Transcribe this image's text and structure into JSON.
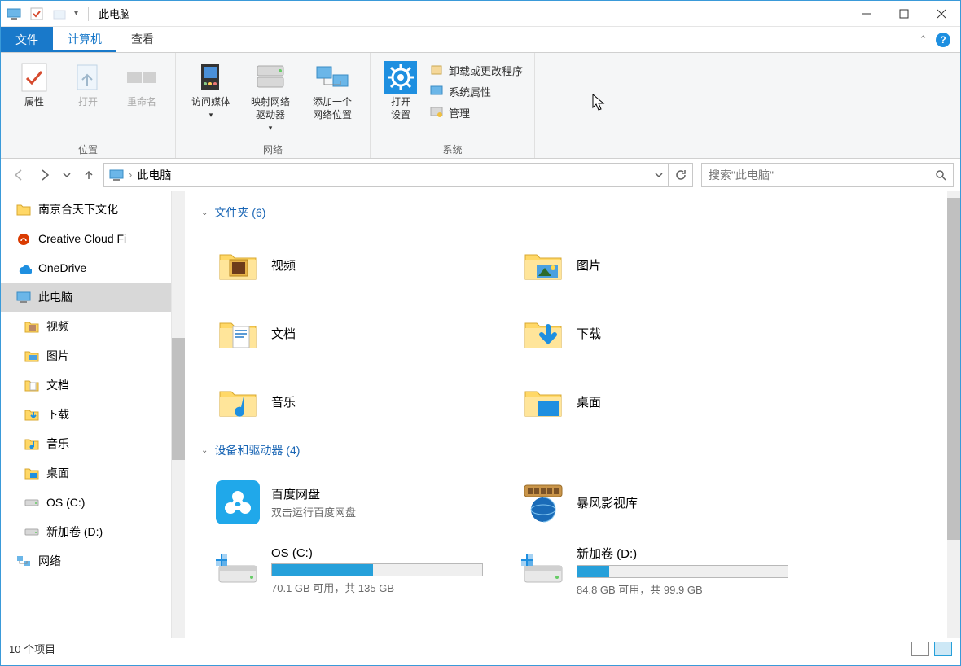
{
  "window": {
    "title": "此电脑"
  },
  "ribbon": {
    "file": "文件",
    "tabs": [
      {
        "label": "计算机",
        "active": true
      },
      {
        "label": "查看",
        "active": false
      }
    ],
    "groups": {
      "location": {
        "label": "位置",
        "props": "属性",
        "open": "打开",
        "rename": "重命名"
      },
      "network": {
        "label": "网络",
        "media": "访问媒体",
        "map": "映射网络\n驱动器",
        "addloc": "添加一个\n网络位置"
      },
      "system": {
        "label": "系统",
        "settings": "打开\n设置",
        "uninstall": "卸载或更改程序",
        "sysprops": "系统属性",
        "manage": "管理"
      }
    }
  },
  "nav": {
    "current": "此电脑",
    "search_placeholder": "搜索\"此电脑\""
  },
  "sidebar": {
    "items": [
      {
        "label": "南京合天下文化",
        "kind": "folder",
        "root": true
      },
      {
        "label": "Creative Cloud Fi",
        "kind": "cc",
        "root": true
      },
      {
        "label": "OneDrive",
        "kind": "onedrive",
        "root": true
      },
      {
        "label": "此电脑",
        "kind": "pc",
        "root": true,
        "selected": true
      },
      {
        "label": "视频",
        "kind": "video"
      },
      {
        "label": "图片",
        "kind": "pictures"
      },
      {
        "label": "文档",
        "kind": "docs"
      },
      {
        "label": "下载",
        "kind": "downloads"
      },
      {
        "label": "音乐",
        "kind": "music"
      },
      {
        "label": "桌面",
        "kind": "desktop"
      },
      {
        "label": "OS (C:)",
        "kind": "drive"
      },
      {
        "label": "新加卷 (D:)",
        "kind": "drive"
      },
      {
        "label": "网络",
        "kind": "network",
        "root": true
      }
    ]
  },
  "content": {
    "folders_header": "文件夹 (6)",
    "folders": [
      {
        "name": "视频",
        "kind": "video"
      },
      {
        "name": "图片",
        "kind": "pictures"
      },
      {
        "name": "文档",
        "kind": "docs"
      },
      {
        "name": "下载",
        "kind": "downloads"
      },
      {
        "name": "音乐",
        "kind": "music"
      },
      {
        "name": "桌面",
        "kind": "desktop"
      }
    ],
    "devices_header": "设备和驱动器 (4)",
    "devices": [
      {
        "name": "百度网盘",
        "sub": "双击运行百度网盘",
        "kind": "baidu"
      },
      {
        "name": "暴风影视库",
        "sub": "",
        "kind": "baofeng"
      },
      {
        "name": "OS (C:)",
        "sub": "70.1 GB 可用，共 135 GB",
        "kind": "drive",
        "fill": 48
      },
      {
        "name": "新加卷 (D:)",
        "sub": "84.8 GB 可用，共 99.9 GB",
        "kind": "drive",
        "fill": 15
      }
    ]
  },
  "status": {
    "text": "10 个项目"
  }
}
